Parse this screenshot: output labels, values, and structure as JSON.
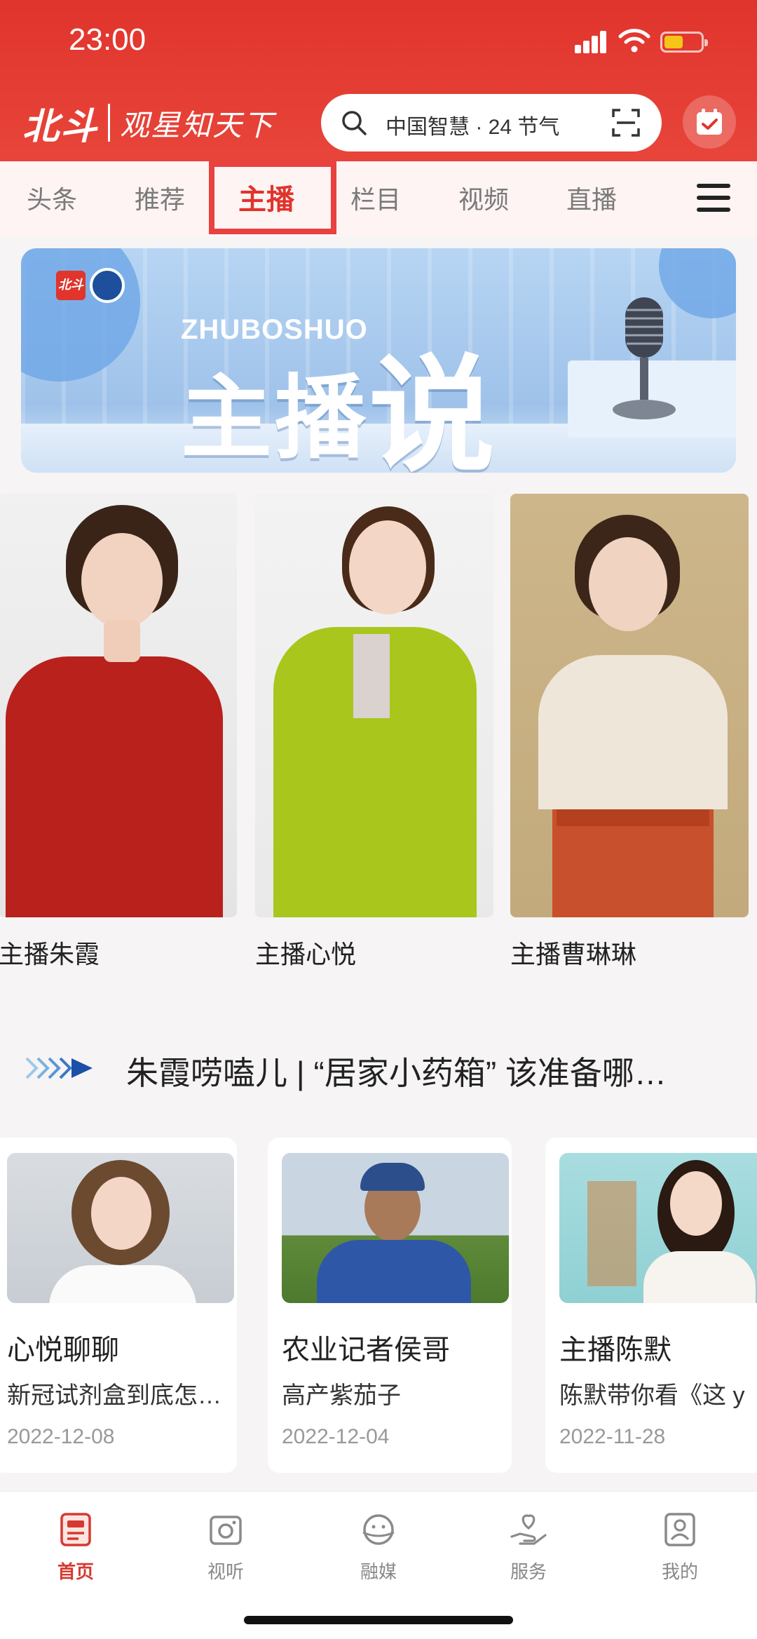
{
  "status_bar": {
    "time": "23:00"
  },
  "header": {
    "logo_text": "北斗",
    "slogan": "观星知天下",
    "search_placeholder": "中国智慧 · 24 节气",
    "accent_color": "#e0342c"
  },
  "tabs": [
    {
      "label": "头条",
      "active": false
    },
    {
      "label": "推荐",
      "active": false
    },
    {
      "label": "主播",
      "active": true
    },
    {
      "label": "栏目",
      "active": false
    },
    {
      "label": "视频",
      "active": false
    },
    {
      "label": "直播",
      "active": false
    }
  ],
  "banner": {
    "logo_mark": "北斗",
    "title_en": "ZHUBOSHUO",
    "title_cn_part1": "主播",
    "title_cn_part2": "说"
  },
  "anchors": [
    {
      "name": "主播朱霞"
    },
    {
      "name": "主播心悦"
    },
    {
      "name": "主播曹琳琳"
    }
  ],
  "section": {
    "title": "朱霞唠嗑儿 | “居家小药箱” 该准备哪…"
  },
  "videos": [
    {
      "title": "心悦聊聊",
      "desc": "新冠试剂盒到底怎…",
      "date": "2022-12-08"
    },
    {
      "title": "农业记者侯哥",
      "desc": "高产紫茄子",
      "date": "2022-12-04"
    },
    {
      "title": "主播陈默",
      "desc": "陈默带你看《这 y",
      "date": "2022-11-28"
    }
  ],
  "bottom_nav": [
    {
      "label": "首页",
      "icon": "home-icon",
      "active": true
    },
    {
      "label": "视听",
      "icon": "camera-icon",
      "active": false
    },
    {
      "label": "融媒",
      "icon": "media-icon",
      "active": false
    },
    {
      "label": "服务",
      "icon": "heart-hand-icon",
      "active": false
    },
    {
      "label": "我的",
      "icon": "profile-icon",
      "active": false
    }
  ]
}
